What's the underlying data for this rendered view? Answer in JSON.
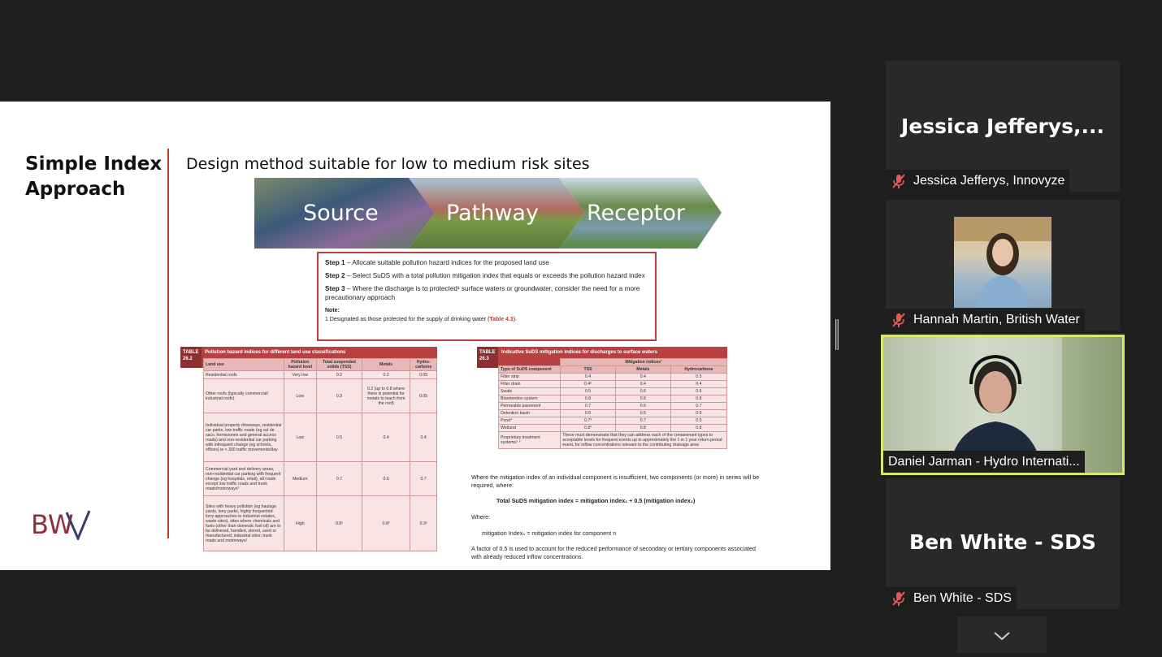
{
  "slide": {
    "title": "Simple Index Approach",
    "subtitle": "Design method suitable for low to medium risk sites",
    "banner": [
      "Source",
      "Pathway",
      "Receptor"
    ],
    "steps": [
      {
        "label": "Step 1",
        "text": " – Allocate suitable pollution hazard indices for the proposed land use"
      },
      {
        "label": "Step 2",
        "text": " – Select SuDS with a total pollution mitigation index that equals or exceeds the pollution hazard index"
      },
      {
        "label": "Step 3",
        "text": " – Where the discharge is to protected¹ surface waters or groundwater, consider the need for a more precautionary approach"
      }
    ],
    "note_label": "Note:",
    "footnote": "1     Designated as those protected for the supply of drinking water (",
    "footnote_ref": "Table 4.3",
    "footnote_end": ").",
    "table1": {
      "number": "TABLE 26.2",
      "title": "Pollution hazard indices for different land use classifications",
      "headers": [
        "Land use",
        "Pollution hazard level",
        "Total suspended solids (TSS)",
        "Metals",
        "Hydro-carbons"
      ],
      "rows": [
        [
          "Residential roofs",
          "Very low",
          "0.2",
          "0.2",
          "0.05"
        ],
        [
          "Other roofs (typically commercial/ industrial roofs)",
          "Low",
          "0.3",
          "0.2 (up to 0.8 where there is potential for metals to leach from the roof)",
          "0.05"
        ],
        [
          "Individual property driveways, residential car parks, low traffic roads (eg cul de sacs, homezones and general access roads) and non-residential car parking with infrequent change (eg schools, offices) ie < 300 traffic movements/day",
          "Low",
          "0.5",
          "0.4",
          "0.4"
        ],
        [
          "Commercial yard and delivery areas, non-residential car parking with frequent change (eg hospitals, retail), all roads except low traffic roads and trunk roads/motorways¹",
          "Medium",
          "0.7",
          "0.6",
          "0.7"
        ],
        [
          "Sites with heavy pollution (eg haulage yards, lorry parks, highly frequented lorry approaches to industrial estates, waste sites), sites where chemicals and fuels (other than domestic fuel oil) are to be delivered, handled, stored, used or manufactured; industrial sites; trunk roads and motorways¹",
          "High",
          "0.8²",
          "0.8²",
          "0.9²"
        ]
      ]
    },
    "table2": {
      "number": "TABLE 26.3",
      "title": "Indicative SuDS mitigation indices for discharges to surface waters",
      "group_header": "Mitigation indices¹",
      "headers": [
        "Type of SuDS component",
        "TSS",
        "Metals",
        "Hydrocarbons"
      ],
      "rows": [
        [
          "Filter strip",
          "0.4",
          "0.4",
          "0.5"
        ],
        [
          "Filter drain",
          "0.4²",
          "0.4",
          "0.4"
        ],
        [
          "Swale",
          "0.5",
          "0.6",
          "0.6"
        ],
        [
          "Bioretention system",
          "0.8",
          "0.8",
          "0.8"
        ],
        [
          "Permeable pavement",
          "0.7",
          "0.6",
          "0.7"
        ],
        [
          "Detention basin",
          "0.5",
          "0.5",
          "0.6"
        ],
        [
          "Pond⁴",
          "0.7³",
          "0.7",
          "0.5"
        ],
        [
          "Wetland",
          "0.8³",
          "0.8",
          "0.8"
        ]
      ],
      "proprietary_label": "Proprietary treatment systems⁵ ⁶",
      "proprietary_text": "These must demonstrate that they can address each of the contaminant types to acceptable levels for frequent events up to approximately the 1 in 1 year return period event, for inflow concentrations relevant to the contributing drainage area"
    },
    "text_para1": "Where the mitigation index of an individual component is insufficient, two components (or more) in series will be required, where:",
    "formula": "Total SuDS mitigation index = mitigation index₁ + 0.5 (mitigation index₂)",
    "where": "Where:",
    "where_def": "mitigation Indexₙ = mitigation index for component n",
    "text_para2": "A factor of 0.5 is used to account for the reduced performance of secondary or tertiary components associated with already reduced inflow concentrations.",
    "logo_text": "BW"
  },
  "participants": [
    {
      "big_name": "Jessica Jefferys,...",
      "label": "Jessica Jefferys, Innovyze",
      "muted": true
    },
    {
      "label": "Hannah Martin, British Water",
      "muted": true
    },
    {
      "label": "Daniel Jarman - Hydro Internati...",
      "muted": false,
      "active": true
    },
    {
      "big_name": "Ben White - SDS",
      "label": "Ben White - SDS",
      "muted": true
    }
  ],
  "colors": {
    "accent": "#b84040",
    "speaker_border": "#d8e86a",
    "mute_icon": "#e05a5a"
  }
}
